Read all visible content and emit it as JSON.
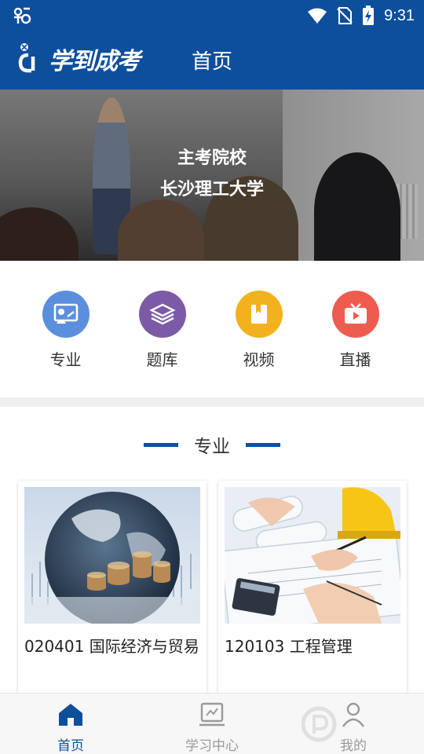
{
  "status_bar": {
    "time": "9:31",
    "icons": [
      "bug-icon",
      "wifi-icon",
      "no-sim-icon",
      "battery-charging-icon"
    ]
  },
  "app_bar": {
    "logo_text": "学到成考",
    "title": "首页"
  },
  "banner": {
    "line1": "主考院校",
    "line2": "长沙理工大学"
  },
  "quick_menu": [
    {
      "label": "专业",
      "icon": "major-icon",
      "color": "#5b8fdc"
    },
    {
      "label": "题库",
      "icon": "question-bank-icon",
      "color": "#7c5aa6"
    },
    {
      "label": "视频",
      "icon": "video-icon",
      "color": "#f2b21e"
    },
    {
      "label": "直播",
      "icon": "live-tv-icon",
      "color": "#ee5c4f"
    }
  ],
  "section": {
    "title": "专业"
  },
  "majors": [
    {
      "name": "020401 国际经济与贸易",
      "image": "globe-coins-photo"
    },
    {
      "name": "120103 工程管理",
      "image": "engineering-blueprint-photo"
    }
  ],
  "bottom_nav": [
    {
      "label": "首页",
      "icon": "home-icon",
      "active": true
    },
    {
      "label": "学习中心",
      "icon": "study-center-icon",
      "active": false
    },
    {
      "label": "我的",
      "icon": "profile-icon",
      "active": false
    }
  ],
  "colors": {
    "primary": "#0e4f9c",
    "inactive": "#9a9a9a"
  }
}
